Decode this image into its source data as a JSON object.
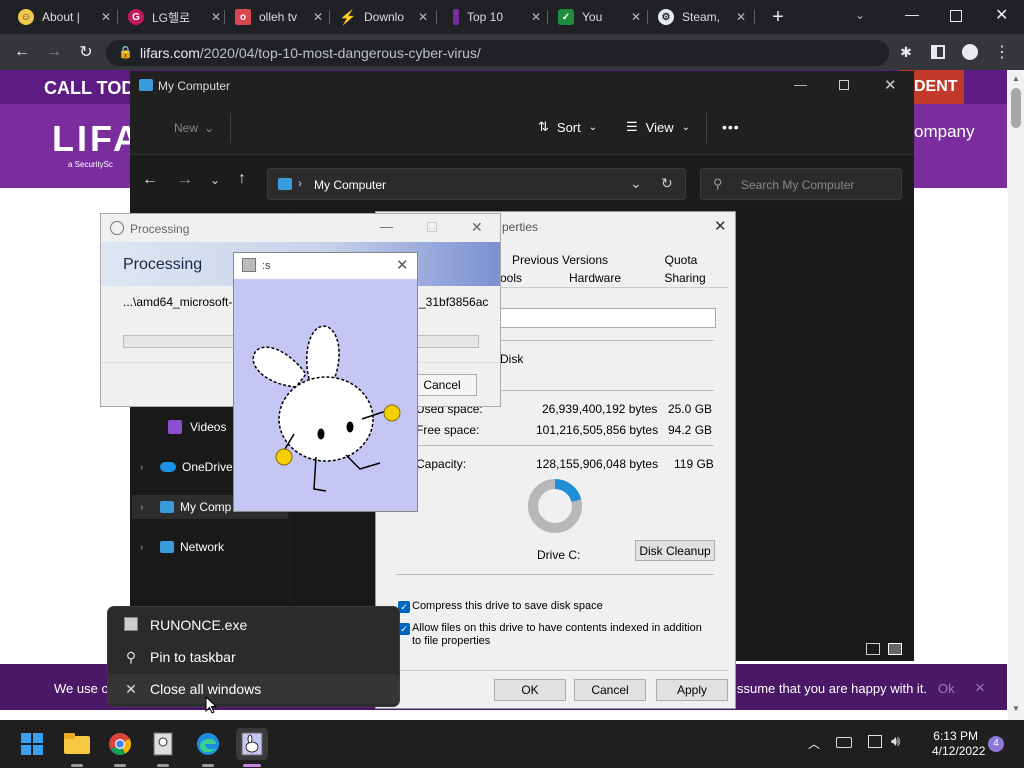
{
  "browser": {
    "tabs": [
      {
        "title": "About |",
        "icon": "chat-bubble-icon",
        "color": "#f2c84b"
      },
      {
        "title": "LG헬로",
        "icon": "lg-logo-icon",
        "color": "#c0185a"
      },
      {
        "title": "olleh tv",
        "icon": "olleh-icon",
        "color": "#d8474f"
      },
      {
        "title": "Downlo",
        "icon": "bolt-icon",
        "color": "#e8eaed"
      },
      {
        "title": "Top 10",
        "icon": "bookmark-icon",
        "color": "#7a2e9e"
      },
      {
        "title": "You",
        "icon": "check-icon",
        "color": "#1e8e3e"
      },
      {
        "title": "Steam,",
        "icon": "steam-icon",
        "color": "#1b2838"
      }
    ],
    "url_host": "lifars.com",
    "url_path": "/2020/04/top-10-most-dangerous-cyber-virus/"
  },
  "website": {
    "call_text": "CALL TOD",
    "logo_text": "LIFA",
    "logo_sub": "a SecuritySc",
    "accident_text": "DENT",
    "company_text": "ompany",
    "cookie_left": "We use c",
    "cookie_right": "ssume that you are happy with it.",
    "cookie_ok": "Ok",
    "cookie_close": "×"
  },
  "explorer": {
    "title": "My Computer",
    "new_label": "New",
    "sort_label": "Sort",
    "view_label": "View",
    "more_label": "•••",
    "address": "My Computer",
    "search_placeholder": "Search My Computer",
    "nav": [
      {
        "label": "Videos",
        "icon": "videos-icon"
      },
      {
        "label": "OneDrive",
        "icon": "onedrive-icon"
      },
      {
        "label": "My Comp",
        "icon": "computer-icon"
      },
      {
        "label": "Network",
        "icon": "network-icon"
      }
    ]
  },
  "properties": {
    "title": "perties",
    "tabs_top": [
      "Previous Versions",
      "Quota"
    ],
    "tabs_bottom": [
      "ools",
      "Hardware",
      "Sharing"
    ],
    "disk_type": "Disk",
    "used_label": "Used space:",
    "used_bytes": "26,939,400,192 bytes",
    "used_gb": "25.0 GB",
    "free_label": "Free space:",
    "free_bytes": "101,216,505,856 bytes",
    "free_gb": "94.2 GB",
    "capacity_label": "Capacity:",
    "capacity_bytes": "128,155,906,048 bytes",
    "capacity_gb": "119 GB",
    "used_fraction": 0.21,
    "drive_label": "Drive C:",
    "cleanup_label": "Disk Cleanup",
    "compress_label": "Compress this drive to save disk space",
    "index_label": "Allow files on this drive to have contents indexed in addition to file properties",
    "ok_label": "OK",
    "cancel_label": "Cancel",
    "apply_label": "Apply"
  },
  "processing": {
    "title": "Processing",
    "heading": "Processing",
    "path_left": "...\\amd64_microsoft-",
    "path_right": "_31bf3856ac",
    "cancel_label": "Cancel"
  },
  "popup": {
    "title": ":s"
  },
  "context_menu": {
    "items": [
      {
        "label": "RUNONCE.exe",
        "icon": "app-icon"
      },
      {
        "label": "Pin to taskbar",
        "icon": "pin-icon"
      },
      {
        "label": "Close all windows",
        "icon": "close-icon"
      }
    ]
  },
  "taskbar": {
    "time": "6:13 PM",
    "date": "4/12/2022",
    "notifications": "4"
  }
}
